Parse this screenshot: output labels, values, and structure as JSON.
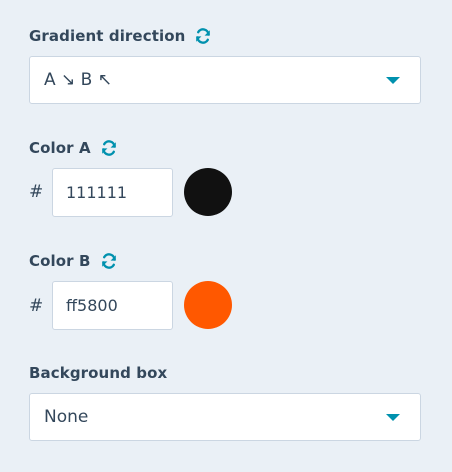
{
  "gradient_direction": {
    "label": "Gradient direction",
    "reset_icon": "refresh-icon",
    "value": "A ↘ B ↖"
  },
  "color_a": {
    "label": "Color A",
    "reset_icon": "refresh-icon",
    "hash": "#",
    "hex": "111111",
    "swatch_color": "#111111"
  },
  "color_b": {
    "label": "Color B",
    "reset_icon": "refresh-icon",
    "hash": "#",
    "hex": "ff5800",
    "swatch_color": "#ff5800"
  },
  "background_box": {
    "label": "Background box",
    "value": "None"
  },
  "colors": {
    "accent": "#0091ae",
    "text": "#33475b",
    "border": "#cbd6e2",
    "panel_bg": "#eaf0f6"
  }
}
